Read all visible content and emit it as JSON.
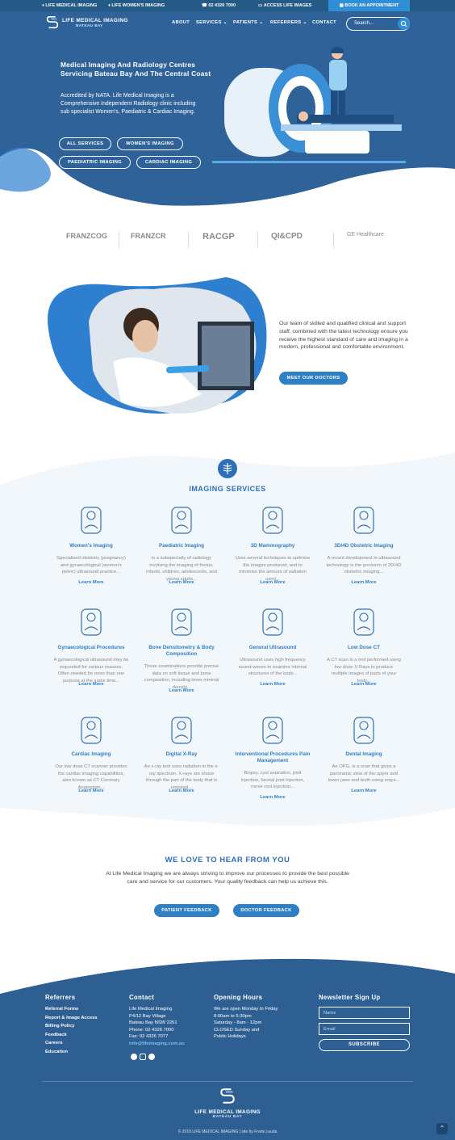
{
  "topbar": {
    "link1": "LIFE MEDICAL IMAGING",
    "link2": "LIFE WOMEN'S IMAGING",
    "phone": "02 4326 7000",
    "access": "ACCESS LIFE IMAGES",
    "book": "BOOK AN APPOINTMENT"
  },
  "brand": {
    "name": "LIFE MEDICAL IMAGING",
    "sub": "BATEAU BAY"
  },
  "nav": {
    "about": "ABOUT",
    "services": "SERVICES",
    "patients": "PATIENTS",
    "referrers": "REFERRERS",
    "contact": "CONTACT"
  },
  "search": {
    "placeholder": "Search..."
  },
  "hero": {
    "title": "Medical Imaging And Radiology Centres Servicing Bateau Bay And The Central Coast",
    "text": "Accredited by NATA. Life Medical Imaging is a Comprehensive Independent Radiology clinic including sub specialist Women's, Paediatric & Cardiac Imaging.",
    "btn_all": "ALL SERVICES",
    "btn_women": "WOMEN'S IMAGING",
    "btn_paed": "PAEDIATRIC IMAGING",
    "btn_card": "CARDIAC IMAGING"
  },
  "partners": [
    "FRANZCOG",
    "FRANZCR",
    "RACGP",
    "QI&CPD",
    "GE Healthcare"
  ],
  "staff": {
    "text": "Our team of skilled and qualified clinical and support staff, combined with the latest technology ensure you receive the highest standard of care and imaging in a modern, professional and comfortable environment.",
    "button": "MEET OUR DOCTORS"
  },
  "services": {
    "heading": "IMAGING SERVICES",
    "learn": "Learn More",
    "items": [
      {
        "title": "Women's Imaging",
        "desc": "Specialised obstetric (pregnancy) and gynaecological (women's pelvic) ultrasound practice..."
      },
      {
        "title": "Paediatric Imaging",
        "desc": "is a subspecialty of radiology involving the imaging of foetus, infants, children, adolescents, and young adults..."
      },
      {
        "title": "3D Mammography",
        "desc": "Uses several techniques to optimise the images produced, and to minimise the amount of radiation used..."
      },
      {
        "title": "3D/4D Obstetric Imaging",
        "desc": "A recent development in ultrasound technology is the provision of 3D/4D obstetric imaging..."
      },
      {
        "title": "Gynaecological Procedures",
        "desc": "A gynaecological ultrasound may be requested for various reasons. Often needed for more than one purpose at the same time..."
      },
      {
        "title": "Bone Densitometry & Body Composition",
        "desc": "These examinations provide precise data on soft tissue and bone composition, including bone-mineral density..."
      },
      {
        "title": "General Ultrasound",
        "desc": "Ultrasound uses high frequency sound-waves to examine internal structures of the body..."
      },
      {
        "title": "Low Dose CT",
        "desc": "A CT scan is a test performed using low dose X-Rays to produce multiple images of parts of your body..."
      },
      {
        "title": "Cardiac Imaging",
        "desc": "Our low dose CT scanner provides the cardiac imaging capabilities, also known as CT Coronary Angiogram..."
      },
      {
        "title": "Digital X-Ray",
        "desc": "An x-ray test uses radiation in the x-ray spectrum. X-rays are shone through the part of the body that is required..."
      },
      {
        "title": "Interventional Procedures Pain Management",
        "desc": "Biopsy, cyst aspiration, joint injection, facetal joint injection, nerve root injection..."
      },
      {
        "title": "Dental Imaging",
        "desc": "An OPG, is a scan that gives a panoramic view of the upper and lower jaws and teeth using xrays..."
      }
    ]
  },
  "feedback": {
    "heading": "WE LOVE TO HEAR FROM YOU",
    "text": "At Life Medical Imaging we are always striving to improve our processes to provide the best possible care and service for our customers. Your quality feedback can help us achieve this.",
    "patient": "PATIENT FEEDBACK",
    "doctor": "DOCTOR FEEDBACK"
  },
  "footer": {
    "referrers_h": "Referrers",
    "referrers": [
      "Referral Forms",
      "Report & Image Access",
      "Billing Policy",
      "Feedback",
      "Careers",
      "Education"
    ],
    "contact_h": "Contact",
    "contact": [
      "Life Medical Imaging",
      "P4/12 Bay Village",
      "Bateau Bay NSW 2261",
      "Phone: 02 4326 7000",
      "Fax: 02 4326 7077"
    ],
    "email": "info@lifeimaging.com.au",
    "hours_h": "Opening Hours",
    "hours": [
      "We are open Monday to Friday",
      "8:00am to 5:30pm",
      "Saturday - 8am - 12pm",
      "CLOSED Sunday and",
      "Public Holidays"
    ],
    "news_h": "Newsletter Sign Up",
    "name_ph": "Name",
    "email_ph": "Email",
    "subscribe": "SUBSCRIBE",
    "copyright": "© 2019 LIFE MEDICAL IMAGING | site by Frank Lauda"
  },
  "colors": {
    "primary": "#2f6299",
    "accent": "#2f8fd4",
    "dark": "#245a86"
  }
}
